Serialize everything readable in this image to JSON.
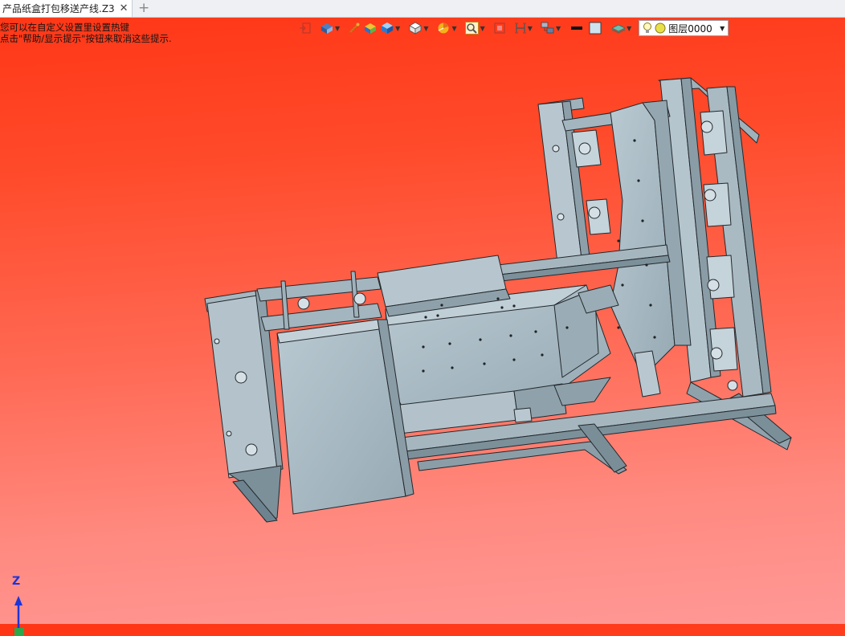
{
  "tabs": [
    {
      "title": "产品纸盒打包移送产线.Z3"
    }
  ],
  "hints": [
    "您可以在自定义设置里设置热键",
    "点击\"帮助/显示提示\"按钮来取消这些提示."
  ],
  "toolbar": {
    "icons": [
      "exit-sketch-icon",
      "view-orient-icon",
      "pick-icon",
      "shaded-box-icon",
      "view-cube-icon",
      "wireframe-cube-icon",
      "render-style-icon",
      "zoom-icon",
      "fit-view-icon",
      "section-icon",
      "view-manager-icon",
      "line-color-icon",
      "face-color-icon",
      "layer-style-icon"
    ],
    "layer": {
      "label": "图层0000"
    }
  },
  "axis": {
    "z_label": "Z"
  },
  "colors": {
    "part": "#aabbc4",
    "edge": "#2a2f33",
    "background_top": "#ff3515",
    "background_bottom": "#ff9896"
  }
}
